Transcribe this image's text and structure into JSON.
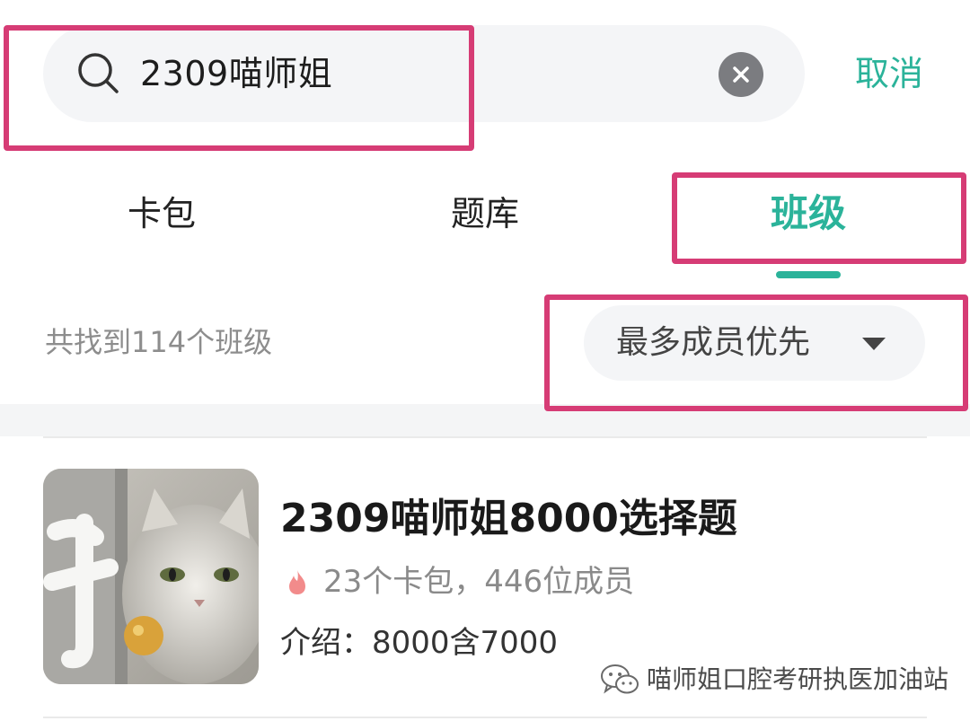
{
  "search": {
    "query": "2309喵师姐",
    "cancel_label": "取消"
  },
  "tabs": [
    {
      "label": "卡包",
      "active": false
    },
    {
      "label": "题库",
      "active": false
    },
    {
      "label": "班级",
      "active": true
    }
  ],
  "results": {
    "count_text": "共找到114个班级",
    "sort_label": "最多成员优先"
  },
  "class_card": {
    "title": "2309喵师姐8000选择题",
    "stats": "23个卡包，446位成员",
    "intro": "介绍：8000含7000"
  },
  "watermark": {
    "text": "喵师姐口腔考研执医加油站"
  },
  "colors": {
    "accent": "#2bb39a",
    "highlight": "#d63c75"
  },
  "icons": {
    "search": "search-icon",
    "clear": "clear-icon",
    "sort": "caret-down-icon",
    "stats": "fire-icon",
    "watermark": "wechat-icon"
  }
}
